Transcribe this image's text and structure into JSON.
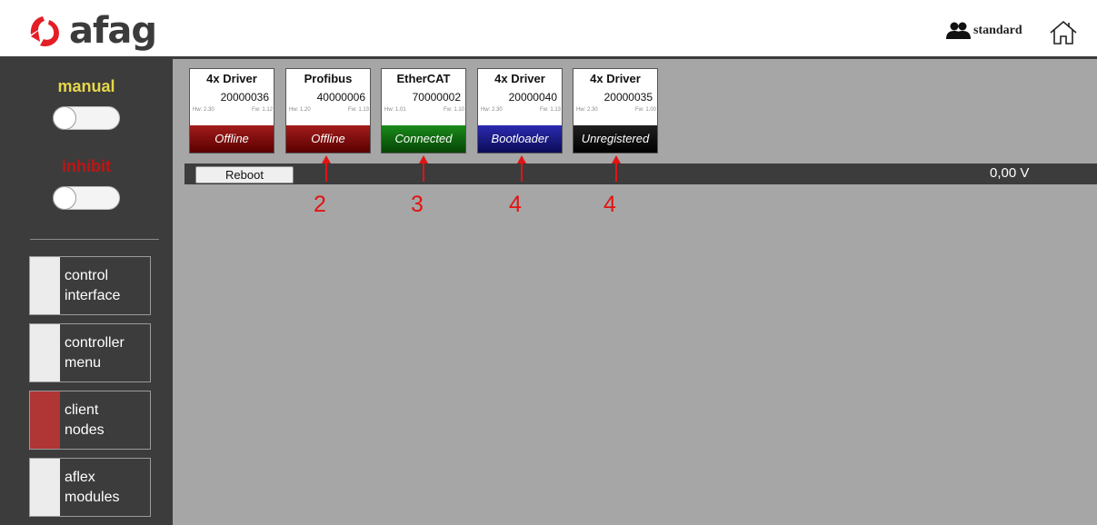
{
  "header": {
    "logo_text": "afag",
    "user_level": "standard",
    "logo_color": "#e31e24"
  },
  "sidebar": {
    "manual_label": "manual",
    "manual_color": "#e6d74a",
    "manual_state": "off",
    "inhibit_label": "inhibit",
    "inhibit_color": "#c01414",
    "inhibit_state": "off",
    "menu": [
      {
        "label": "control\ninterface",
        "active": false
      },
      {
        "label": "controller\nmenu",
        "active": false
      },
      {
        "label": "client\nnodes",
        "active": true
      },
      {
        "label": "aflex\nmodules",
        "active": false
      }
    ]
  },
  "modules": [
    {
      "type": "4x Driver",
      "serial": "20000036",
      "hw": "Hw: 2.30",
      "fw": "Fw: 1.12",
      "status": "Offline",
      "status_color": "red"
    },
    {
      "type": "Profibus",
      "serial": "40000006",
      "hw": "Hw: 1.20",
      "fw": "Fw: 1.13",
      "status": "Offline",
      "status_color": "red"
    },
    {
      "type": "EtherCAT",
      "serial": "70000002",
      "hw": "Hw: 1.01",
      "fw": "Fw: 1.10",
      "status": "Connected",
      "status_color": "green"
    },
    {
      "type": "4x Driver",
      "serial": "20000040",
      "hw": "Hw: 2.30",
      "fw": "Fw: 1.13",
      "status": "Bootloader",
      "status_color": "blue"
    },
    {
      "type": "4x Driver",
      "serial": "20000035",
      "hw": "Hw: 2.30",
      "fw": "Fw: 1.00",
      "status": "Unregistered",
      "status_color": "black"
    }
  ],
  "toolbar": {
    "reboot_label": "Reboot",
    "voltage": "0,00 V"
  },
  "annotations": [
    "2",
    "3",
    "4",
    "4"
  ],
  "annotation_color": "#e11414"
}
